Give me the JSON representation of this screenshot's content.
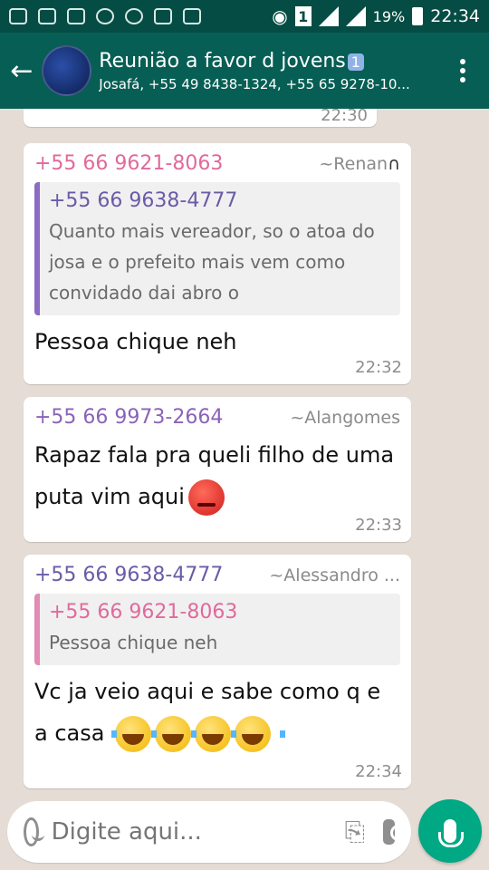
{
  "status": {
    "battery": "19%",
    "time": "22:34",
    "sim_badge": "1"
  },
  "header": {
    "title": "Reunião a favor d jovens",
    "title_badge": "1",
    "subtitle": "Josafá, +55 49 8438-1324, +55 65 9278-10...",
    "colors": {
      "bar": "#075e54",
      "statusbar": "#054d44"
    }
  },
  "previous_time": "22:30",
  "messages": [
    {
      "sender": "+55 66 9621-8063",
      "sender_color": "#e06a9b",
      "alias": "~Renan",
      "alias_icon": "headphones-icon",
      "quote": {
        "name": "+55 66 9638-4777",
        "text": "Quanto mais vereador, so o atoa do josa e o prefeito mais vem como convidado dai abro o"
      },
      "text": "Pessoa chique neh",
      "time": "22:32"
    },
    {
      "sender": "+55 66 9973-2664",
      "sender_color": "#8a63b8",
      "alias": "~Alangomes",
      "text": "Rapaz fala pra queli filho de uma puta vim aqui",
      "emoji": "angry-face-emoji",
      "time": "22:33"
    },
    {
      "sender": "+55 66 9638-4777",
      "sender_color": "#6b5ba6",
      "alias": "~Alessandro ...",
      "quote": {
        "name": "+55 66 9621-8063",
        "text": "Pessoa chique neh"
      },
      "text": "Vc ja veio aqui e sabe como q e a casa",
      "emoji": "tears-of-joy-emoji",
      "emoji_count": 4,
      "time": "22:34"
    }
  ],
  "input": {
    "placeholder": "Digite aqui..."
  },
  "accent": "#00a884"
}
